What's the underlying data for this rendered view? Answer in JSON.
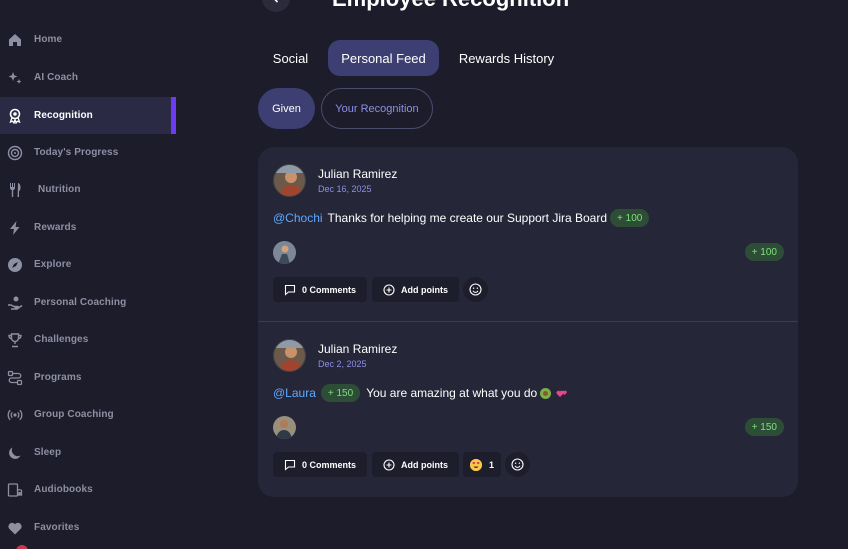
{
  "sidebar": {
    "items": [
      {
        "label": "Home",
        "icon": "home-icon"
      },
      {
        "label": "AI Coach",
        "icon": "sparkle-icon"
      },
      {
        "label": "Recognition",
        "icon": "award-icon",
        "active": true
      },
      {
        "label": "Today's Progress",
        "icon": "target-icon"
      },
      {
        "label": "Nutrition",
        "icon": "utensils-icon"
      },
      {
        "label": "Rewards",
        "icon": "bolt-icon"
      },
      {
        "label": "Explore",
        "icon": "compass-icon"
      },
      {
        "label": "Personal Coaching",
        "icon": "hand-heart-icon"
      },
      {
        "label": "Challenges",
        "icon": "trophy-icon"
      },
      {
        "label": "Programs",
        "icon": "route-icon"
      },
      {
        "label": "Group Coaching",
        "icon": "broadcast-icon"
      },
      {
        "label": "Sleep",
        "icon": "moon-icon"
      },
      {
        "label": "Audiobooks",
        "icon": "audiobook-icon"
      },
      {
        "label": "Favorites",
        "icon": "heart-icon"
      }
    ]
  },
  "header": {
    "title": "Employee Recognition"
  },
  "tabs": [
    {
      "label": "Social"
    },
    {
      "label": "Personal Feed",
      "active": true
    },
    {
      "label": "Rewards History"
    }
  ],
  "filters": [
    {
      "label": "Given",
      "active": true
    },
    {
      "label": "Your Recognition"
    }
  ],
  "feed": {
    "posts": [
      {
        "author": "Julian Ramirez",
        "date": "Dec 16, 2025",
        "mention": "@Chochi",
        "message": "Thanks for helping me create our Support Jira Board",
        "points_inline": "+ 100",
        "points_total": "+ 100",
        "comments_label": "0 Comments",
        "add_points_label": "Add points"
      },
      {
        "author": "Julian Ramirez",
        "date": "Dec 2, 2025",
        "mention": "@Laura",
        "points_inline": "+ 150",
        "message": "You are amazing at what you do",
        "points_total": "+ 150",
        "comments_label": "0 Comments",
        "add_points_label": "Add points",
        "reaction_count": "1"
      }
    ]
  },
  "colors": {
    "background": "#1c1c2a",
    "accent": "#6b3cf3",
    "tab_active": "#3d3f72",
    "points_bg": "#2e4d37",
    "points_text": "#7ee07d",
    "mention": "#5da9ff"
  }
}
